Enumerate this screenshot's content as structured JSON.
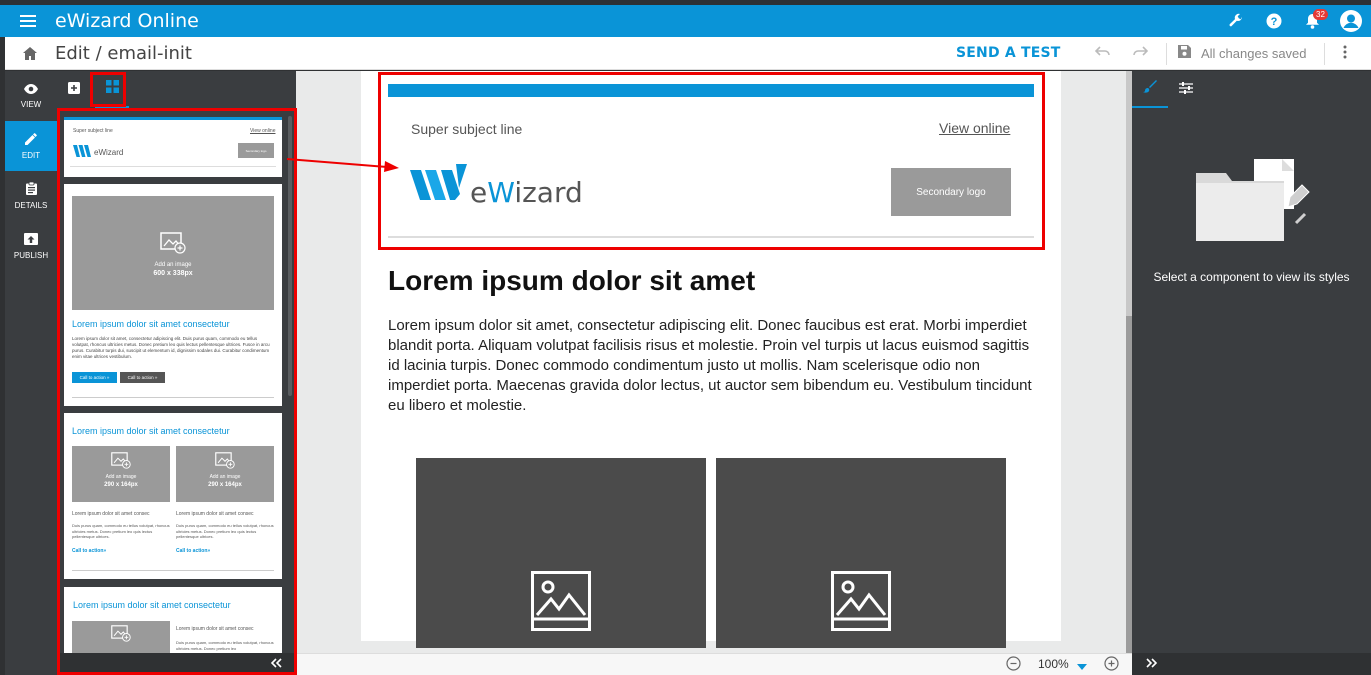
{
  "app": {
    "title": "eWizard Online",
    "notification_count": "32"
  },
  "toolbar": {
    "breadcrumb": "Edit / email-init",
    "send_test": "SEND A TEST",
    "save_status": "All changes saved"
  },
  "rail": [
    {
      "label": "VIEW",
      "icon": "eye-icon"
    },
    {
      "label": "EDIT",
      "icon": "pencil-icon"
    },
    {
      "label": "DETAILS",
      "icon": "clipboard-icon"
    },
    {
      "label": "PUBLISH",
      "icon": "publish-icon"
    }
  ],
  "thumbs": {
    "header": {
      "subject": "Super subject line",
      "view_online": "View online",
      "brand": "eWizard",
      "secondary": "Secondary logo"
    },
    "hero": {
      "add_image": "Add an image",
      "size": "600 x 338px",
      "title": "Lorem ipsum dolor sit amet consectetur",
      "text": "Lorem ipsum dolor sit amet, consectetur adipiscing elit. Duis purus quam, commodo eu tellus volutpat, rhoncus ultricies metus. Donec pretium leo quis lectus pellentesque ultrices. Fusce in arcu purus. Curabitur turpis dui, suscipit ut elementum id, dignissim sodales dui. Curabitur condimentum enim vitae ultrices vestibulum.",
      "cta1": "Call to action »",
      "cta2": "Call to action »"
    },
    "two_col": {
      "title": "Lorem ipsum dolor sit amet consectetur",
      "add_image": "Add an image",
      "size": "290 x 164px",
      "col_title": "Lorem ipsum dolor sit amet consec",
      "col_text": "Duis purus quam, commodo eu tellus volutpat, rhoncus ultricies metus. Donec pretium leo quis lectus pellentesque ultrices.",
      "cta": "Call to action»"
    },
    "side": {
      "title": "Lorem ipsum dolor sit amet consectetur",
      "col_title": "Lorem ipsum dolor sit amet consec",
      "col_text": "Duis purus quam, commodo eu tellus volutpat, rhoncus ultricies metus. Donec pretium leo"
    }
  },
  "email": {
    "subject": "Super subject line",
    "view_online": "View online",
    "brand_e": "e",
    "brand_w": "W",
    "brand_rest": "izard",
    "secondary_logo": "Secondary logo",
    "headline": "Lorem ipsum dolor sit amet",
    "body": "Lorem ipsum dolor sit amet, consectetur adipiscing elit. Donec faucibus est erat. Morbi imperdiet blandit porta. Aliquam volutpat facilisis risus et molestie. Proin vel turpis ut lacus euismod sagittis id lacinia turpis. Donec commodo condimentum justo ut mollis. Nam scelerisque odio non imperdiet porta. Maecenas gravida dolor lectus, ut auctor sem bibendum eu. Vestibulum tincidunt eu libero et molestie."
  },
  "zoom": {
    "value": "100%"
  },
  "right_panel": {
    "message": "Select a component to view its styles"
  },
  "colors": {
    "accent": "#0a94d7",
    "dark_panel": "#3a3d40",
    "highlight": "#ee0000"
  }
}
